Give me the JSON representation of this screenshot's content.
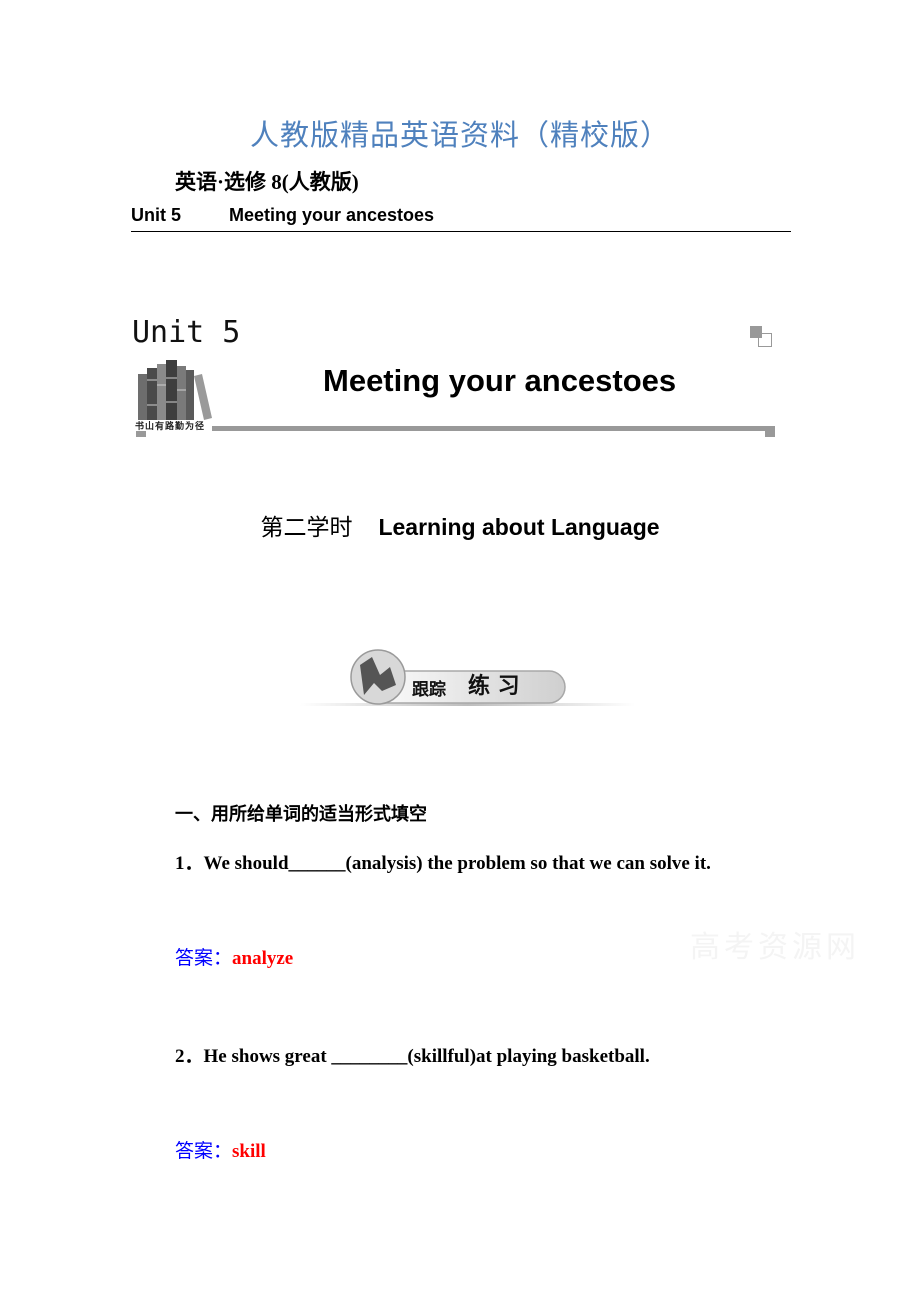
{
  "document": {
    "title": "人教版精品英语资料（精校版）",
    "subject": "英语·选修 8(人教版)",
    "header": {
      "unit": "Unit 5",
      "unit_title": "Meeting your ancestoes"
    },
    "banner": {
      "unit_label": "Unit 5",
      "main_title": "Meeting your ancestoes",
      "motto": "书山有路勤为径",
      "icons": [
        "books-image",
        "corner-squares-icon"
      ]
    },
    "lesson": {
      "period": "第二学时",
      "title": "Learning about Language"
    },
    "practice_banner": {
      "label": "跟踪练习",
      "icon": "climber-image"
    },
    "watermark": "高考资源网",
    "section": {
      "heading": "一、用所给单词的适当形式填空",
      "questions": [
        {
          "number": "1．",
          "text": "We should______(analysis) the problem so that we can solve it.",
          "answer_label": "答案：",
          "answer": "analyze"
        },
        {
          "number": "2．",
          "text": "He shows great ________(skillful)at playing basketball.",
          "answer_label": "答案：",
          "answer": "skill"
        }
      ]
    }
  },
  "colors": {
    "title": "#4f81bd",
    "answer_label": "#0000ff",
    "answer_value": "#ff0000",
    "rule": "#999999"
  }
}
